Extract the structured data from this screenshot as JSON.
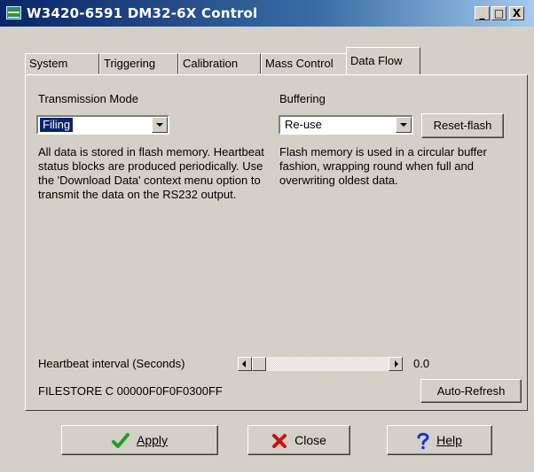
{
  "window": {
    "title": "W3420-6591 DM32-6X Control",
    "controls": {
      "minimize": "_",
      "maximize": "□",
      "close": "X"
    }
  },
  "tabs": [
    {
      "label": "System",
      "active": false
    },
    {
      "label": "Triggering",
      "active": false
    },
    {
      "label": "Calibration",
      "active": false
    },
    {
      "label": "Mass Control",
      "active": false
    },
    {
      "label": "Data Flow",
      "active": true
    }
  ],
  "transmission": {
    "label": "Transmission Mode",
    "value": "Filing",
    "description": "All data is stored in flash memory. Heartbeat status blocks are produced periodically. Use the 'Download Data' context menu option to transmit the data on the RS232 output."
  },
  "buffering": {
    "label": "Buffering",
    "value": "Re-use",
    "reset_label": "Reset-flash",
    "description": "Flash memory is used in a circular buffer fashion, wrapping round when full and overwriting oldest data."
  },
  "heartbeat": {
    "label": "Heartbeat interval (Seconds)",
    "value": "0.0",
    "slider_level": 0
  },
  "status": {
    "text": "FILESTORE C 00000F0F0F0300FF",
    "auto_refresh_label": "Auto-Refresh"
  },
  "footer": {
    "apply": {
      "label": "Apply",
      "icon": "check-icon",
      "color": "#1f9e1f"
    },
    "close": {
      "label": "Close",
      "icon": "x-icon",
      "color": "#cc1111"
    },
    "help": {
      "label": "Help",
      "icon": "question-icon",
      "color": "#1a2fd0"
    }
  }
}
